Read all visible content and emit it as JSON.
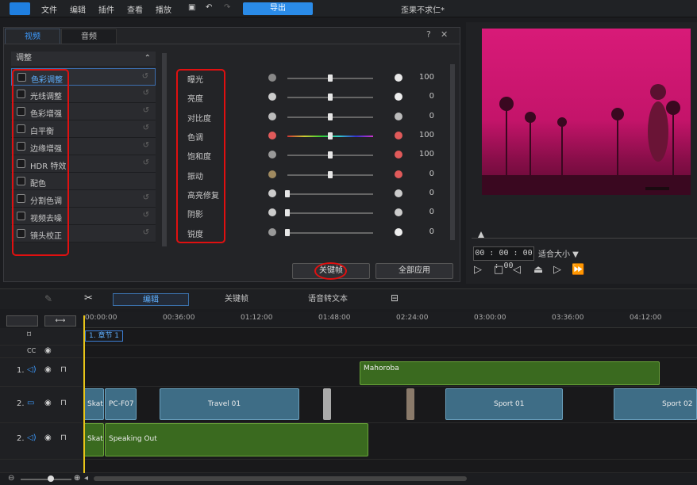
{
  "menubar": {
    "items": [
      "文件",
      "编辑",
      "插件",
      "查看",
      "播放"
    ],
    "export_label": "导出",
    "window_title": "歪果不求仁*"
  },
  "panel": {
    "tabs": [
      "视频",
      "音频"
    ],
    "help": "?",
    "close": "✕",
    "list_header": "调整",
    "adjust_items": [
      "色彩调整",
      "光线调整",
      "色彩增强",
      "白平衡",
      "边缘增强",
      "HDR 特效",
      "配色",
      "分割色调",
      "视频去噪",
      "镜头校正"
    ],
    "params": [
      {
        "label": "曝光",
        "value": "100",
        "level": 0.5,
        "left_icon": "circle-dim-icon",
        "right_icon": "circle-bright-icon"
      },
      {
        "label": "亮度",
        "value": "0",
        "level": 0.5,
        "left_icon": "sun-small-icon",
        "right_icon": "sun-large-icon"
      },
      {
        "label": "对比度",
        "value": "0",
        "level": 0.5,
        "left_icon": "contrast-icon",
        "right_icon": "contrast-icon"
      },
      {
        "label": "色调",
        "value": "100",
        "level": 0.5,
        "left_icon": "rgb-dots-icon",
        "right_icon": "rgb-dots-icon"
      },
      {
        "label": "饱和度",
        "value": "100",
        "level": 0.5,
        "left_icon": "gray-dots-icon",
        "right_icon": "rgb-dots-icon"
      },
      {
        "label": "振动",
        "value": "0",
        "level": 0.5,
        "left_icon": "muted-dots-icon",
        "right_icon": "rgb-dots-icon"
      },
      {
        "label": "高亮修复",
        "value": "0",
        "level": 0.0,
        "left_icon": "half-circle-icon",
        "right_icon": "half-circle-icon"
      },
      {
        "label": "阴影",
        "value": "0",
        "level": 0.0,
        "left_icon": "half-circle-icon",
        "right_icon": "half-circle-icon"
      },
      {
        "label": "锐度",
        "value": "0",
        "level": 0.0,
        "left_icon": "gradient-square-icon",
        "right_icon": "checker-square-icon"
      }
    ],
    "keyframe_label": "关键帧",
    "apply_all_label": "全部应用"
  },
  "preview": {
    "timecode": "00 : 00 : 00 : 00",
    "fit_label": "适合大小 ▼",
    "progress": 0
  },
  "timeline": {
    "tabs": [
      "编辑",
      "关键帧",
      "语音转文本"
    ],
    "ruler": [
      "00:00:00",
      "00:36:00",
      "01:12:00",
      "01:48:00",
      "02:24:00",
      "03:00:00",
      "03:36:00",
      "04:12:00"
    ],
    "chapter": "1. 章节 1",
    "tracks": [
      {
        "num": "1."
      },
      {
        "num": "2."
      },
      {
        "num": "2."
      }
    ],
    "clips": {
      "mahoroba": "Mahoroba",
      "skat": "Skat",
      "pc": "PC-F07",
      "travel": "Travel 01",
      "sport1": "Sport 01",
      "sport2": "Sport 02",
      "skat2": "Skat",
      "speaking": "Speaking Out"
    }
  },
  "colors": {
    "accent": "#2a8be8",
    "highlight": "#e01010",
    "video_clip": "#3e6d86",
    "audio_clip": "#3a6a1f"
  }
}
